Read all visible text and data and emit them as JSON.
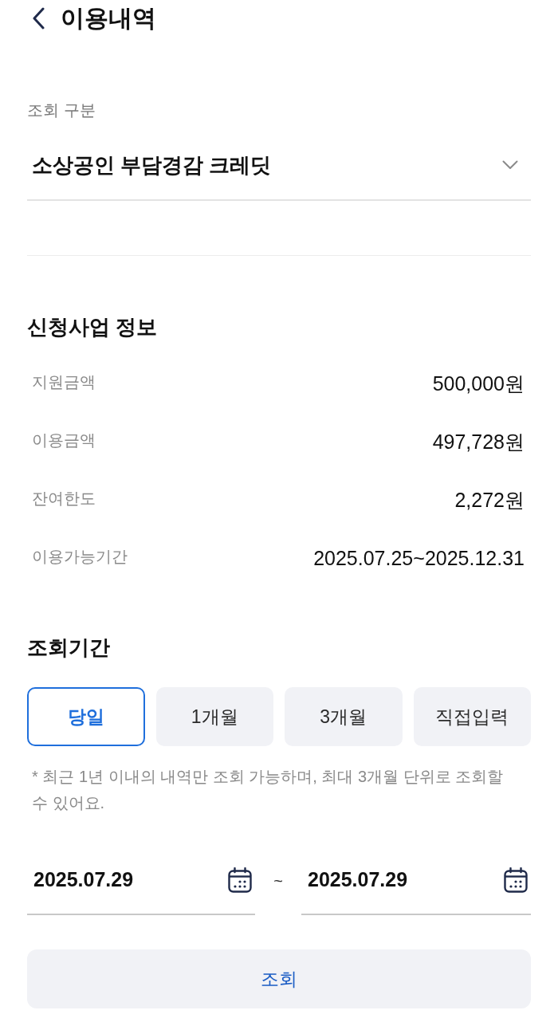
{
  "header": {
    "title": "이용내역"
  },
  "inquiry_type": {
    "label": "조회 구분",
    "value": "소상공인 부담경감 크레딧"
  },
  "program_info": {
    "title": "신청사업 정보",
    "rows": [
      {
        "label": "지원금액",
        "value": "500,000원"
      },
      {
        "label": "이용금액",
        "value": "497,728원"
      },
      {
        "label": "잔여한도",
        "value": "2,272원"
      },
      {
        "label": "이용가능기간",
        "value": "2025.07.25~2025.12.31"
      }
    ]
  },
  "period": {
    "title": "조회기간",
    "options": [
      {
        "label": "당일",
        "selected": true
      },
      {
        "label": "1개월",
        "selected": false
      },
      {
        "label": "3개월",
        "selected": false
      },
      {
        "label": "직접입력",
        "selected": false
      }
    ],
    "note": "* 최근 1년 이내의 내역만 조회 가능하며, 최대 3개월 단위로 조회할 수 있어요.",
    "start_date": "2025.07.29",
    "separator": "~",
    "end_date": "2025.07.29"
  },
  "search_button": "조회"
}
